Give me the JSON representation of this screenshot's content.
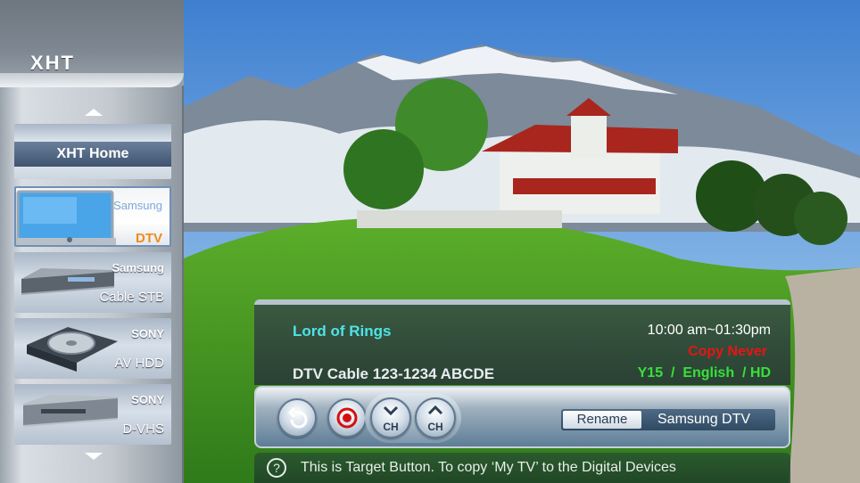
{
  "brand": "XHT",
  "sidebar": {
    "home_label": "XHT  Home",
    "devices": [
      {
        "brand": "Samsung",
        "type": "DTV",
        "icon": "tv-icon",
        "active": true
      },
      {
        "brand": "Samsung",
        "type": "Cable STB",
        "icon": "set-top-box-icon",
        "active": false
      },
      {
        "brand": "SONY",
        "type": "AV HDD",
        "icon": "hdd-recorder-icon",
        "active": false
      },
      {
        "brand": "SONY",
        "type": "D-VHS",
        "icon": "vcr-icon",
        "active": false
      }
    ]
  },
  "info": {
    "program": "Lord of Rings",
    "channel": "DTV Cable 123-1234 ABCDE",
    "time": "10:00 am~01:30pm",
    "copy": "Copy Never",
    "attributes": "Y15  /  English  / HD"
  },
  "controls": {
    "back_icon": "back-arrow-icon",
    "record_icon": "record-icon",
    "ch_down_label": "CH",
    "ch_up_label": "CH",
    "rename_label": "Rename",
    "device_name": "Samsung DTV"
  },
  "help": {
    "icon": "?",
    "text": "This is Target Button. To copy  ‘My TV’ to the Digital Devices"
  },
  "colors": {
    "program_title": "#4fe3e8",
    "copy_status": "#e81414",
    "attributes": "#39e03a",
    "active_device_type": "#f08a1c"
  }
}
